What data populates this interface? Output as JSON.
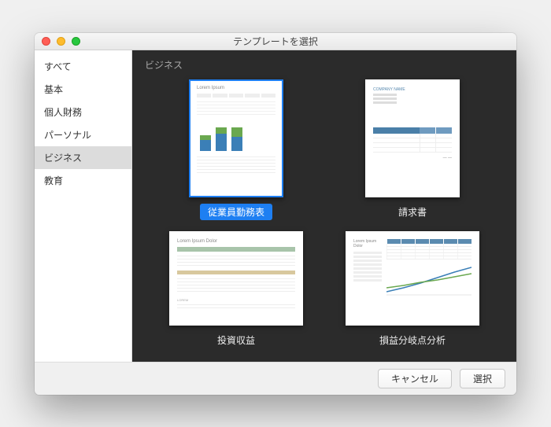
{
  "window": {
    "title": "テンプレートを選択"
  },
  "sidebar": {
    "items": [
      {
        "label": "すべて"
      },
      {
        "label": "基本"
      },
      {
        "label": "個人財務"
      },
      {
        "label": "パーソナル"
      },
      {
        "label": "ビジネス"
      },
      {
        "label": "教育"
      }
    ],
    "selected_index": 4
  },
  "section": {
    "title": "ビジネス"
  },
  "templates": [
    {
      "label": "従業員勤務表",
      "selected": true
    },
    {
      "label": "請求書",
      "selected": false
    },
    {
      "label": "投資収益",
      "selected": false
    },
    {
      "label": "損益分岐点分析",
      "selected": false
    }
  ],
  "footer": {
    "cancel": "キャンセル",
    "choose": "選択"
  }
}
